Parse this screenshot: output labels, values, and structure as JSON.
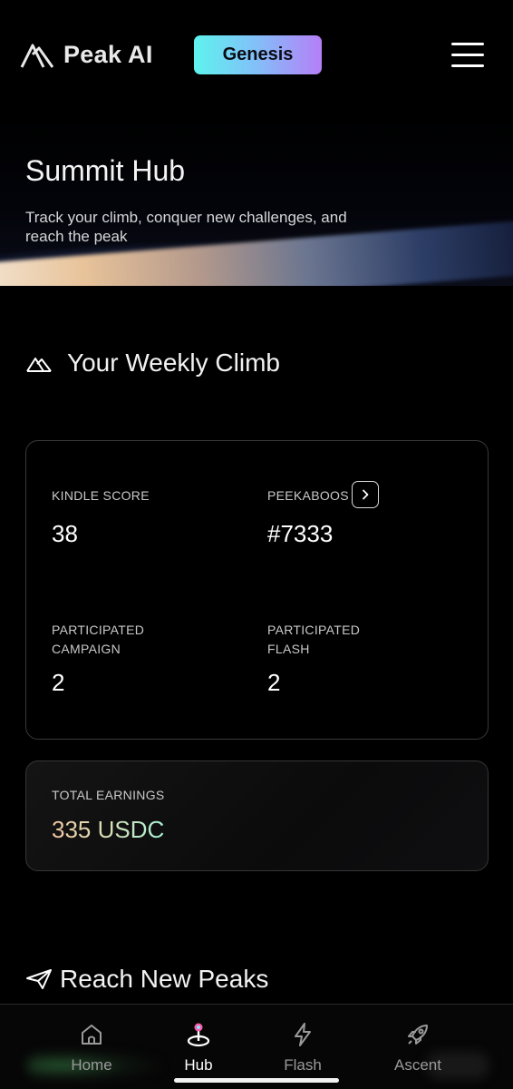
{
  "header": {
    "app_name": "Peak AI",
    "badge_label": "Genesis",
    "colors": {
      "badge_gradient": [
        "#5ef3ee",
        "#b57ff7"
      ]
    }
  },
  "hero": {
    "title": "Summit Hub",
    "subtitle": "Track your climb, conquer new challenges, and reach the peak"
  },
  "weekly": {
    "heading": "Your Weekly Climb",
    "icon": "mountain-icon",
    "stats": [
      {
        "label": "KINDLE SCORE",
        "value": "38"
      },
      {
        "label": "PEEKABOOS",
        "value": "#7333"
      },
      {
        "label": "PARTICIPATED CAMPAIGN",
        "value": "2"
      },
      {
        "label": "PARTICIPATED FLASH",
        "value": "2"
      }
    ]
  },
  "earnings": {
    "label": "TOTAL EARNINGS",
    "value": "335 USDC"
  },
  "peaks": {
    "heading": "Reach New Peaks",
    "icon": "paper-plane-icon"
  },
  "nav": {
    "items": [
      {
        "label": "Home",
        "icon": "home-icon"
      },
      {
        "label": "Hub",
        "icon": "hub-icon",
        "active": true
      },
      {
        "label": "Flash",
        "icon": "lightning-icon"
      },
      {
        "label": "Ascent",
        "icon": "rocket-icon"
      }
    ]
  }
}
